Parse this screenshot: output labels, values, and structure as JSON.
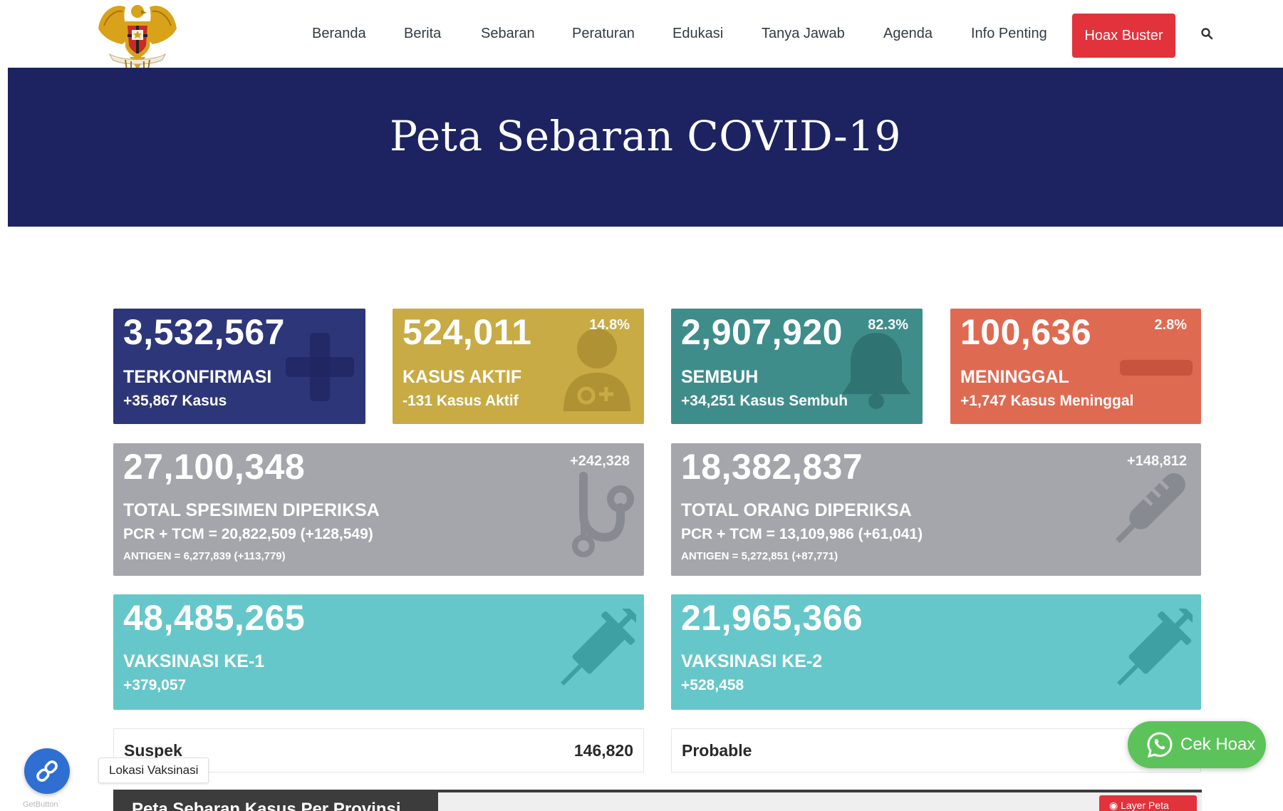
{
  "nav": {
    "items": [
      "Beranda",
      "Berita",
      "Sebaran",
      "Peraturan",
      "Edukasi",
      "Tanya Jawab",
      "Agenda",
      "Info Penting"
    ],
    "hoax_button": "Hoax Buster"
  },
  "banner": {
    "title": "Peta Sebaran COVID-19"
  },
  "stats": {
    "confirmed": {
      "value": "3,532,567",
      "label": "TERKONFIRMASI",
      "delta": "+35,867 Kasus"
    },
    "active": {
      "value": "524,011",
      "percent": "14.8%",
      "label": "KASUS AKTIF",
      "delta": "-131 Kasus Aktif"
    },
    "recovered": {
      "value": "2,907,920",
      "percent": "82.3%",
      "label": "SEMBUH",
      "delta": "+34,251 Kasus Sembuh"
    },
    "deaths": {
      "value": "100,636",
      "percent": "2.8%",
      "label": "MENINGGAL",
      "delta": "+1,747 Kasus Meninggal"
    },
    "specimens": {
      "value": "27,100,348",
      "change": "+242,328",
      "label": "TOTAL SPESIMEN DIPERIKSA",
      "pcr": "PCR + TCM = 20,822,509 (+128,549)",
      "antigen": "ANTIGEN = 6,277,839 (+113,779)"
    },
    "people": {
      "value": "18,382,837",
      "change": "+148,812",
      "label": "TOTAL ORANG DIPERIKSA",
      "pcr": "PCR + TCM = 13,109,986 (+61,041)",
      "antigen": "ANTIGEN = 5,272,851 (+87,771)"
    },
    "vaccine1": {
      "value": "48,485,265",
      "label": "VAKSINASI KE-1",
      "delta": "+379,057"
    },
    "vaccine2": {
      "value": "21,965,366",
      "label": "VAKSINASI KE-2",
      "delta": "+528,458"
    }
  },
  "suspek": {
    "label": "Suspek",
    "value": "146,820"
  },
  "probable": {
    "label": "Probable"
  },
  "widgets": {
    "fab_caption": "GetButton",
    "tooltip": "Lokasi Vaksinasi",
    "cek_hoax": "Cek Hoax",
    "map_title": "Peta Sebaran Kasus Per Provinsi",
    "layer_button": "Layer Peta"
  },
  "colors": {
    "banner": "#1c2360",
    "confirmed": "#2d3678",
    "active": "#c8ab45",
    "recovered": "#3e8d8b",
    "deaths": "#df6a52",
    "specimens": "#a4a6ab",
    "vaccine": "#65c7c9",
    "hoax": "#e2323c",
    "whatsapp": "#5cc35a"
  }
}
